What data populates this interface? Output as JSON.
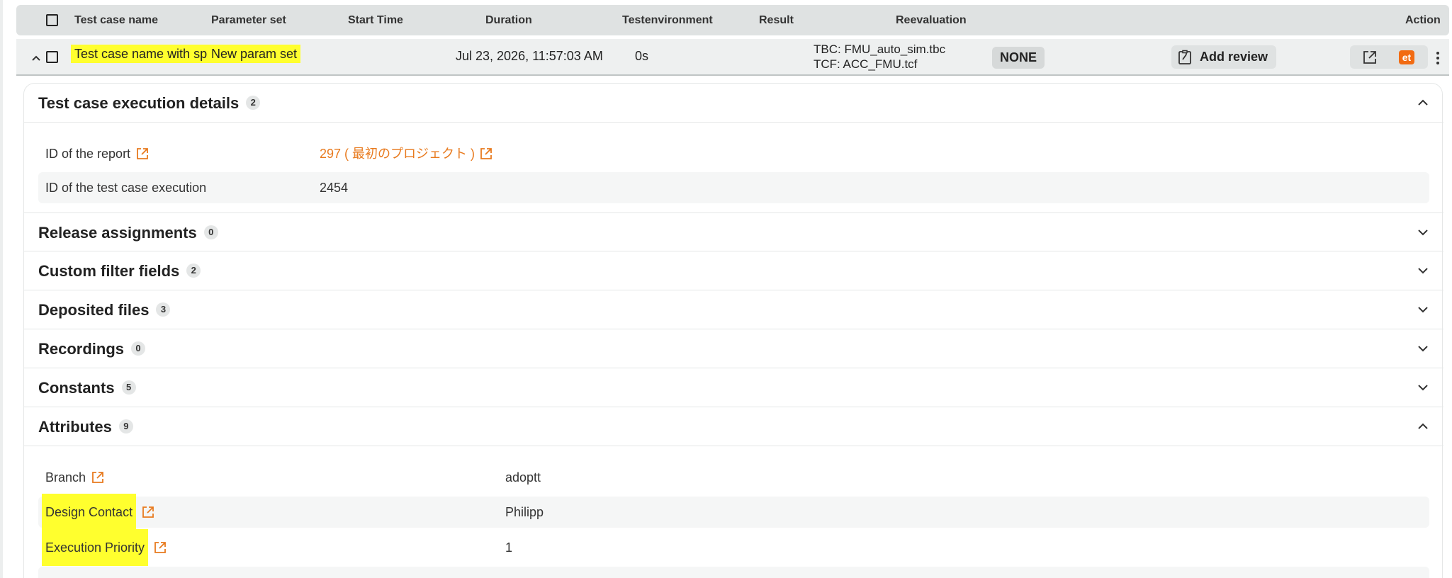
{
  "header": {
    "columns": [
      "Test case name",
      "Parameter set",
      "Start Time",
      "Duration",
      "Testenvironment",
      "Result",
      "Reevaluation",
      "Action"
    ]
  },
  "row": {
    "test_case_name": "Test case name with spaces",
    "parameter_set": "New param set",
    "start_time": "Jul 23, 2026, 11:57:03 AM",
    "duration": "0s",
    "tbc": "TBC: FMU_auto_sim.tbc",
    "tcf": "TCF: ACC_FMU.tcf",
    "result": "NONE",
    "review_label": "Add review",
    "et_label": "et"
  },
  "sections": {
    "execution_details": {
      "title": "Test case execution details",
      "count": "2"
    },
    "release": {
      "title": "Release assignments",
      "count": "0"
    },
    "custom_filter": {
      "title": "Custom filter fields",
      "count": "2"
    },
    "deposited": {
      "title": "Deposited files",
      "count": "3"
    },
    "recordings": {
      "title": "Recordings",
      "count": "0"
    },
    "constants": {
      "title": "Constants",
      "count": "5"
    },
    "attributes": {
      "title": "Attributes",
      "count": "9"
    }
  },
  "details": {
    "report_id_label": "ID of the report",
    "report_id_value": "297 ( 最初のプロジェクト )",
    "execution_id_label": "ID of the test case execution",
    "execution_id_value": "2454"
  },
  "attributes": [
    {
      "key": "Branch",
      "value": "adoptt"
    },
    {
      "key": "Design Contact",
      "value": "Philipp"
    },
    {
      "key": "Execution Priority",
      "value": "1"
    }
  ],
  "colors": {
    "accent": "#e87a1e",
    "highlight": "#ffff2e",
    "header_bg": "#dfe2e2"
  }
}
